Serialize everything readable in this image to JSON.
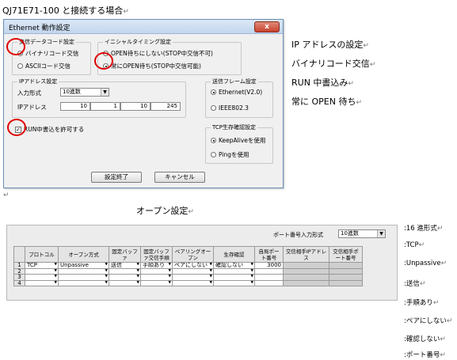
{
  "doc": {
    "heading": "QJ71E71-100 と接続する場合",
    "side_notes": [
      "IP アドレスの設定",
      "バイナリコード交信",
      "RUN 中書込み",
      "常に OPEN 待ち"
    ],
    "open_caption": "オープン設定",
    "table_notes": [
      ":16 進形式",
      ":TCP",
      ":Unpassive",
      ":送信",
      ":手順あり",
      ":ペアにしない",
      ":確認しない",
      ":ポート番号"
    ]
  },
  "dialog": {
    "title": "Ethernet 動作設定",
    "close_label": "x",
    "comm_code": {
      "legend": "交信データコード設定",
      "options": [
        "バイナリコード交信",
        "ASCIIコード交信"
      ],
      "selected_index": 0
    },
    "init_timing": {
      "legend": "イニシャルタイミング設定",
      "options": [
        "OPEN待ちにしない(STOP中交信不可)",
        "常にOPEN待ち(STOP中交信可能)"
      ],
      "selected_index": 1
    },
    "ip": {
      "legend": "IPアドレス設定",
      "input_format_label": "入力形式",
      "input_format_value": "10進数",
      "ip_label": "IPアドレス",
      "octets": [
        "10",
        "1",
        "10",
        "245"
      ]
    },
    "frame": {
      "legend": "送信フレーム設定",
      "options": [
        "Ethernet(V2.0)",
        "IEEE802.3"
      ],
      "selected_index": 0
    },
    "run_write": {
      "label": "RUN中書込を許可する",
      "checked": true
    },
    "tcp_alive": {
      "legend": "TCP生存確認設定",
      "options": [
        "KeepAliveを使用",
        "Pingを使用"
      ],
      "selected_index": 0
    },
    "ok_label": "設定終了",
    "cancel_label": "キャンセル"
  },
  "open_table": {
    "port_format_label": "ポート番号入力形式",
    "port_format_value": "10進数",
    "headers": [
      "",
      "プロトコル",
      "オープン方式",
      "固定バッファ",
      "固定バッファ交信手順",
      "ペアリングオープン",
      "生存確認",
      "自局ポート番号",
      "交信相手IPアドレス",
      "交信相手ポート番号"
    ],
    "rows": [
      [
        "1",
        "TCP",
        "Unpassive",
        "送信",
        "手順あり",
        "ペアにしない",
        "確認しない",
        "3000",
        "",
        ""
      ],
      [
        "2",
        "",
        "",
        "",
        "",
        "",
        "",
        "",
        "",
        ""
      ],
      [
        "3",
        "",
        "",
        "",
        "",
        "",
        "",
        "",
        "",
        ""
      ],
      [
        "4",
        "",
        "",
        "",
        "",
        "",
        "",
        "",
        "",
        ""
      ]
    ]
  }
}
